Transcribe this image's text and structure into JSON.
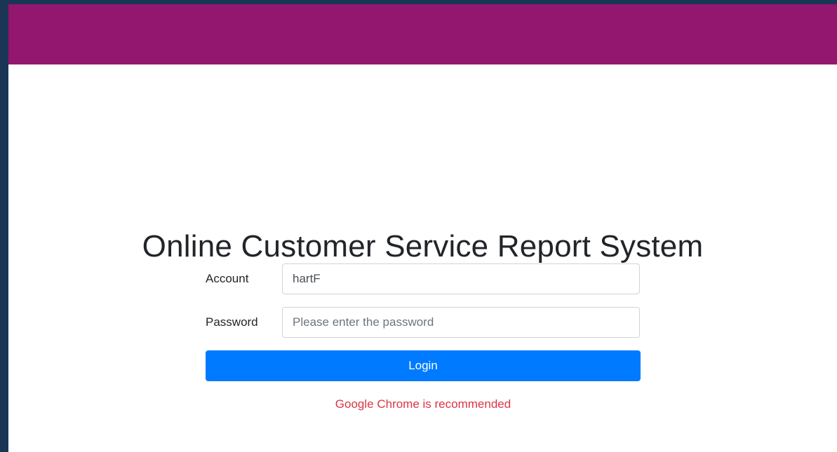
{
  "colors": {
    "desktop_background": "#1a3654",
    "banner": "#93166f",
    "primary_button": "#007bff",
    "notice_text": "#dc3545"
  },
  "page": {
    "title": "Online Customer Service Report System"
  },
  "form": {
    "account_label": "Account",
    "account_value": "hartF",
    "password_label": "Password",
    "password_placeholder": "Please enter the password",
    "login_label": "Login"
  },
  "notice": "Google Chrome is recommended"
}
